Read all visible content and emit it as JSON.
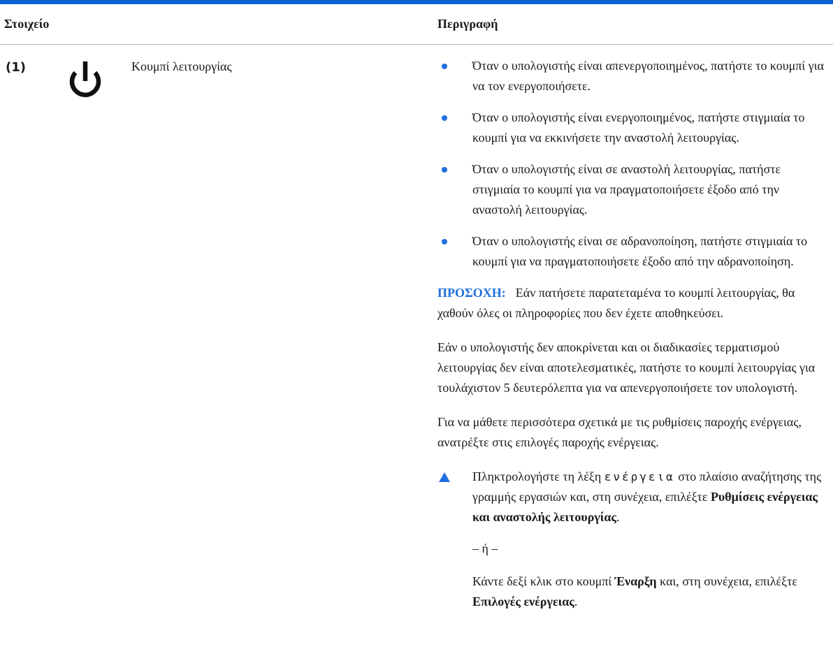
{
  "header": {
    "col_item": "Στοιχείο",
    "col_description": "Περιγραφή"
  },
  "row": {
    "index": "(1)",
    "icon": "power-icon",
    "name": "Κουμπί λειτουργίας",
    "bullets": [
      "Όταν ο υπολογιστής είναι απενεργοποιημένος, πατήστε το κουμπί για να τον ενεργοποιήσετε.",
      "Όταν ο υπολογιστής είναι ενεργοποιημένος, πατήστε στιγμιαία το κουμπί για να εκκινήσετε την αναστολή λειτουργίας.",
      "Όταν ο υπολογιστής είναι σε αναστολή λειτουργίας, πατήστε στιγμιαία το κουμπί για να πραγματοποιήσετε έξοδο από την αναστολή λειτουργίας.",
      "Όταν ο υπολογιστής είναι σε αδρανοποίηση, πατήστε στιγμιαία το κουμπί για να πραγματοποιήσετε έξοδο από την αδρανοποίηση."
    ],
    "caution_label": "ΠΡΟΣΟΧΗ:",
    "caution_text": "Εάν πατήσετε παρατεταμένα το κουμπί λειτουργίας, θα χαθούν όλες οι πληροφορίες που δεν έχετε αποθηκεύσει.",
    "paragraph_1": "Εάν ο υπολογιστής δεν αποκρίνεται και οι διαδικασίες τερματισμού λειτουργίας δεν είναι αποτελεσματικές, πατήστε το κουμπί λειτουργίας για τουλάχιστον 5 δευτερόλεπτα για να απενεργοποιήσετε τον υπολογιστή.",
    "paragraph_2": "Για να μάθετε περισσότερα σχετικά με τις ρυθμίσεις παροχής ενέργειας, ανατρέξτε στις επιλογές παροχής ενέργειας.",
    "step": {
      "t1": "Πληκτρολογήστε τη λέξη ",
      "code": "ενέργεια",
      "t2": " στο πλαίσιο αναζήτησης της γραμμής εργασιών και, στη συνέχεια, επιλέξτε ",
      "bold1": "Ρυθμίσεις ενέργειας και αναστολής λειτουργίας",
      "t3": ".",
      "or": "– ή –",
      "t4": "Κάντε δεξί κλικ στο κουμπί ",
      "bold2": "Έναρξη",
      "t5": " και, στη συνέχεια, επιλέξτε ",
      "bold3": "Επιλογές ενέργειας",
      "t6": "."
    }
  },
  "colors": {
    "accent": "#1f6fe0",
    "top_rule": "#0a63d6"
  }
}
